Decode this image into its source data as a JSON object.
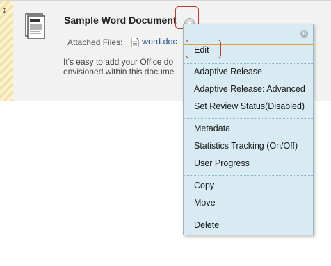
{
  "item": {
    "title": "Sample Word Document",
    "attached_label": "Attached Files:",
    "file_name": "word.doc",
    "description": "It's easy to add your Office do                            . This\nenvisioned within this docume",
    "icons": {
      "drag": "move-vertical-icon",
      "document": "document-icon",
      "file": "file-icon",
      "menu": "chevron-down-icon"
    }
  },
  "context_menu": {
    "close_icon": "close-icon",
    "groups": [
      [
        {
          "label": "Edit"
        }
      ],
      [
        {
          "label": "Adaptive Release"
        },
        {
          "label": "Adaptive Release: Advanced"
        },
        {
          "label": "Set Review Status(Disabled)"
        }
      ],
      [
        {
          "label": "Metadata"
        },
        {
          "label": "Statistics Tracking (On/Off)"
        },
        {
          "label": "User Progress"
        }
      ],
      [
        {
          "label": "Copy"
        },
        {
          "label": "Move"
        }
      ],
      [
        {
          "label": "Delete"
        }
      ]
    ]
  },
  "colors": {
    "menu_background": "#d8eaf2",
    "menu_accent": "#e0a040",
    "highlight": "#c0392b",
    "link": "#1f5c99"
  }
}
